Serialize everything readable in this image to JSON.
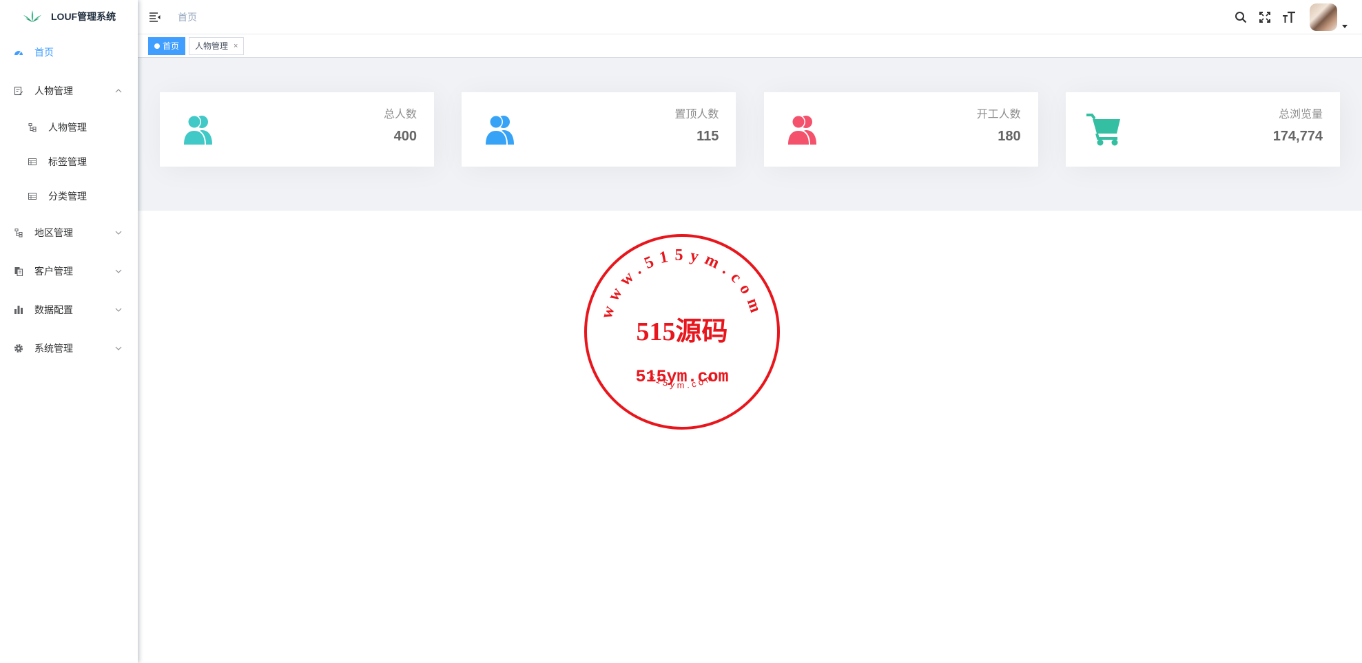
{
  "app": {
    "title": "LOUF管理系统"
  },
  "sidebar": {
    "items": [
      {
        "label": "首页"
      },
      {
        "label": "人物管理",
        "children": [
          {
            "label": "人物管理"
          },
          {
            "label": "标签管理"
          },
          {
            "label": "分类管理"
          }
        ]
      },
      {
        "label": "地区管理"
      },
      {
        "label": "客户管理"
      },
      {
        "label": "数据配置"
      },
      {
        "label": "系统管理"
      }
    ]
  },
  "header": {
    "breadcrumb": "首页"
  },
  "tags": [
    {
      "label": "首页"
    },
    {
      "label": "人物管理",
      "close": "×"
    }
  ],
  "stats": [
    {
      "label": "总人数",
      "value": "400",
      "color": "#40c9c6",
      "icon": "peoples-icon"
    },
    {
      "label": "置顶人数",
      "value": "115",
      "color": "#36a3f7",
      "icon": "peoples-icon"
    },
    {
      "label": "开工人数",
      "value": "180",
      "color": "#f4516c",
      "icon": "peoples-icon"
    },
    {
      "label": "总浏览量",
      "value": "174,774",
      "color": "#34bfa3",
      "icon": "shopping-cart-icon"
    }
  ],
  "watermark": {
    "ring_text": "www.515ym.com",
    "main_text": "515源码",
    "url_text": "515ym.com",
    "bottom_text": "515ym.com",
    "color": "#e8161c"
  },
  "colors": {
    "accent": "#409eff"
  }
}
